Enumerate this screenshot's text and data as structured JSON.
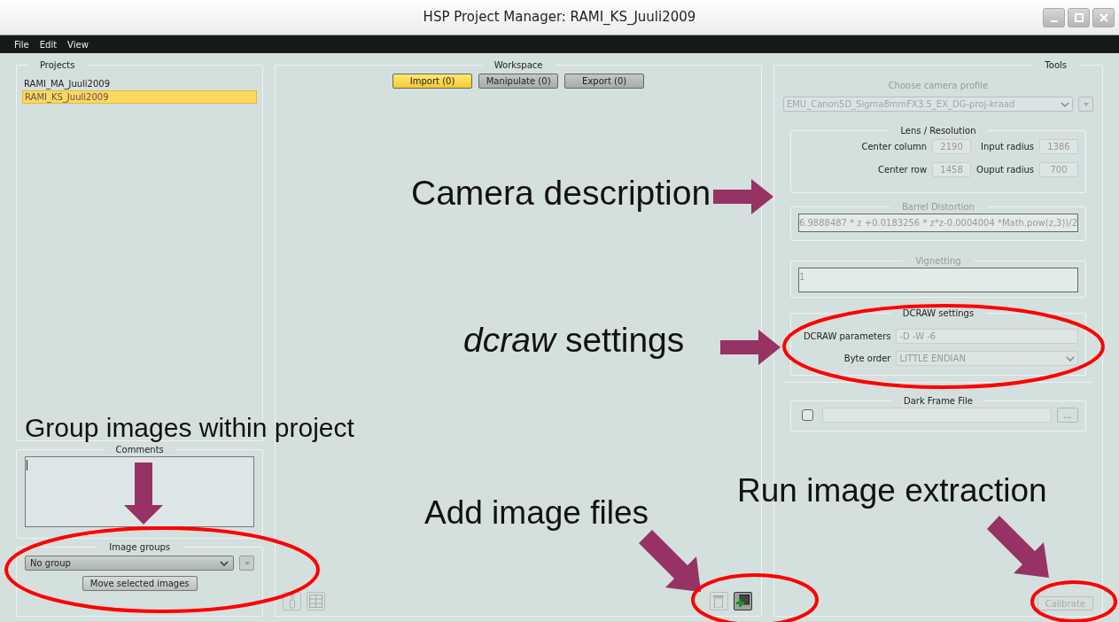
{
  "window": {
    "title": "HSP Project Manager: RAMI_KS_Juuli2009"
  },
  "menu": [
    "File",
    "Edit",
    "View"
  ],
  "projects": {
    "title": "Projects",
    "items": [
      {
        "label": "RAMI_MA_Juuli2009",
        "selected": false
      },
      {
        "label": "RAMI_KS_Juuli2009",
        "selected": true
      }
    ]
  },
  "comments": {
    "title": "Comments"
  },
  "image_groups": {
    "title": "Image groups",
    "group": "No group",
    "move_button": "Move selected images"
  },
  "workspace": {
    "title": "Workspace",
    "tabs": [
      {
        "label": "Import (0)",
        "selected": true
      },
      {
        "label": "Manipulate (0)",
        "selected": false
      },
      {
        "label": "Export (0)",
        "selected": false
      }
    ]
  },
  "tools": {
    "title": "Tools",
    "camera_profile_label": "Choose camera profile",
    "camera_profile": "EMU_Canon5D_Sigma8mmFX3.5_EX_DG-proj-kraad",
    "lens": {
      "title": "Lens / Resolution",
      "fields": [
        {
          "label": "Center column",
          "value": "2190"
        },
        {
          "label": "Input radius",
          "value": "1386"
        },
        {
          "label": "Center row",
          "value": "1458"
        },
        {
          "label": "Ouput radius",
          "value": "700"
        }
      ]
    },
    "barrel": {
      "title": "Barrel Distortion",
      "value": "6.9888487 * z +0.0183256 * z*z-0.0004004 *Math.pow(z,3))/2"
    },
    "vignetting": {
      "title": "Vignetting",
      "value": "1"
    },
    "dcraw": {
      "title": "DCRAW settings",
      "parameters_label": "DCRAW parameters",
      "parameters": "-D -W -6",
      "byte_order_label": "Byte order",
      "byte_order": "LITTLE ENDIAN"
    },
    "dark_frame": {
      "title": "Dark Frame File",
      "checked": false,
      "browse": "..."
    },
    "calibrate": "Calibrate"
  },
  "annotations": [
    {
      "text": "Camera description"
    },
    {
      "text": "*dcraw* settings"
    },
    {
      "text": "Group images within project"
    },
    {
      "text": "Add image files"
    },
    {
      "text": "Run image extraction"
    }
  ]
}
